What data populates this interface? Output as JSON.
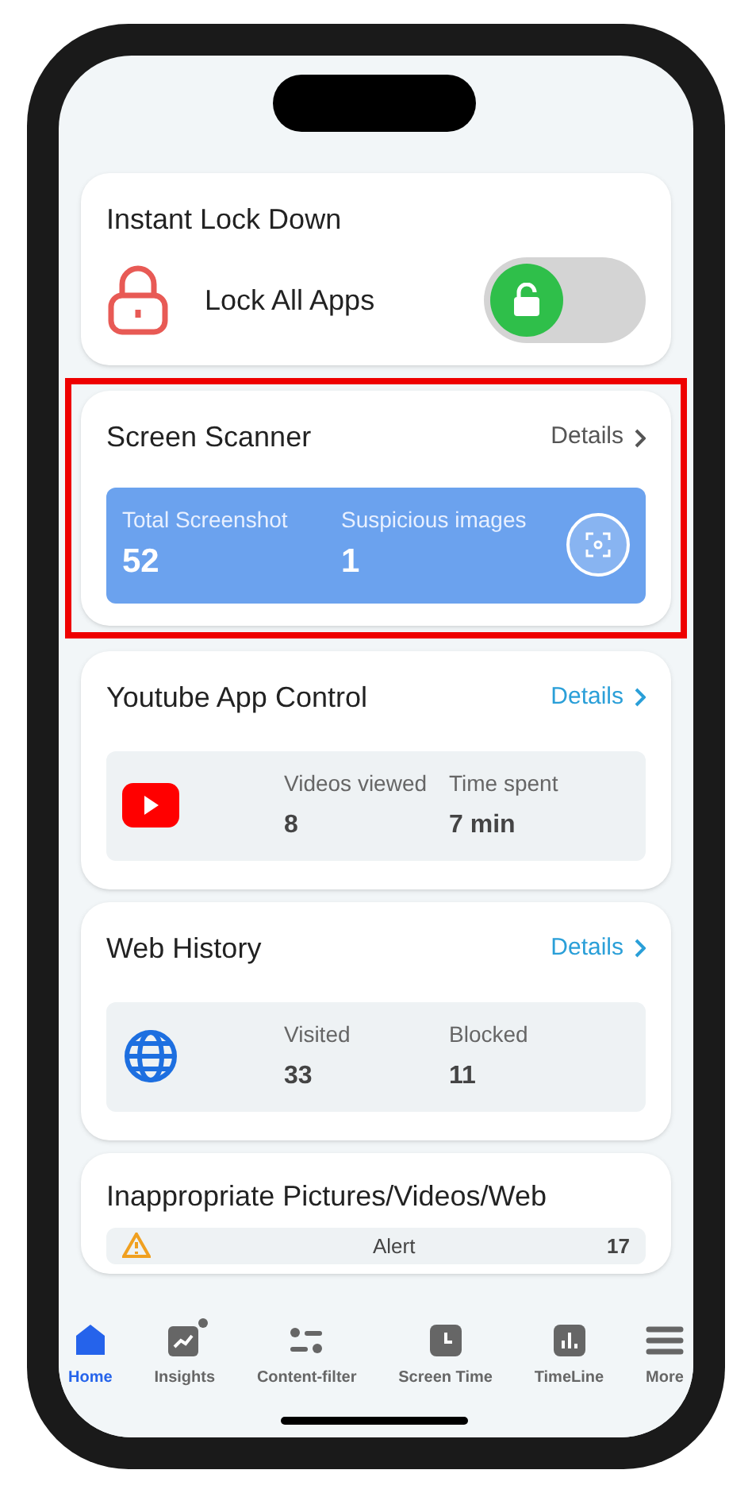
{
  "lock_card": {
    "title": "Instant Lock Down",
    "label": "Lock All Apps",
    "on": false
  },
  "scanner_card": {
    "title": "Screen Scanner",
    "details": "Details",
    "highlighted": true,
    "stats": [
      {
        "label": "Total Screenshot",
        "value": "52"
      },
      {
        "label": "Suspicious images",
        "value": "1"
      }
    ]
  },
  "cards": [
    {
      "kind": "youtube",
      "title": "Youtube App Control",
      "details": "Details",
      "stats": [
        {
          "label": "Videos viewed",
          "value": "8"
        },
        {
          "label": "Time spent",
          "value": "7 min"
        }
      ]
    },
    {
      "kind": "web",
      "title": "Web History",
      "details": "Details",
      "stats": [
        {
          "label": "Visited",
          "value": "33"
        },
        {
          "label": "Blocked",
          "value": "11"
        }
      ]
    }
  ],
  "alert_card": {
    "title": "Inappropriate Pictures/Videos/Web",
    "label": "Alert",
    "value": "17"
  },
  "tab_bar": [
    {
      "kind": "home",
      "label": "Home",
      "selected": true,
      "badge": false
    },
    {
      "kind": "insights",
      "label": "Insights",
      "selected": false,
      "badge": true
    },
    {
      "kind": "filter",
      "label": "Content-filter",
      "selected": false,
      "badge": false
    },
    {
      "kind": "clock",
      "label": "Screen Time",
      "selected": false,
      "badge": false
    },
    {
      "kind": "chart",
      "label": "TimeLine",
      "selected": false,
      "badge": false
    },
    {
      "kind": "menu",
      "label": "More",
      "selected": false,
      "badge": false
    }
  ]
}
